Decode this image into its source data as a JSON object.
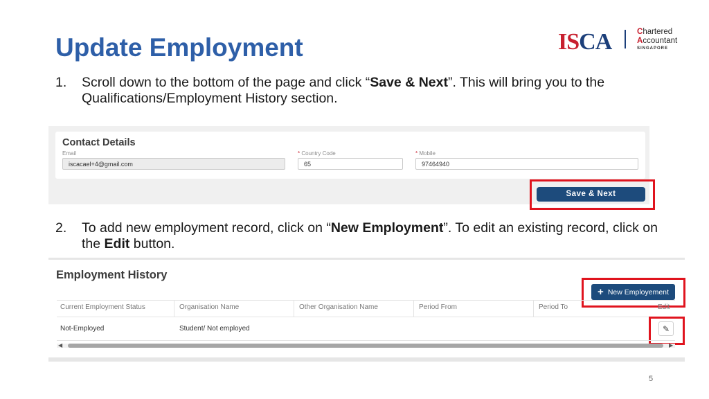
{
  "slide": {
    "title": "Update Employment",
    "page_number": "5"
  },
  "logo": {
    "isca_letters": [
      "I",
      "S",
      "C",
      "A"
    ],
    "line1_cap": "C",
    "line1_rest": "hartered",
    "line2_cap": "A",
    "line2_rest": "ccountant",
    "line3": "SINGAPORE",
    "colors": {
      "red": "#c8202f",
      "navy": "#1c3f7a"
    }
  },
  "step1": {
    "number": "1.",
    "text_before": "Scroll down to the bottom of the page and click “",
    "bold": "Save & Next",
    "text_after": "”. This will bring you to the Qualifications/Employment History section."
  },
  "step2": {
    "number": "2.",
    "text_before": "To add new employment record, click on “",
    "bold1": "New Employment",
    "text_middle": "”. To edit an existing record, click on the ",
    "bold2": "Edit",
    "text_after": " button."
  },
  "contact": {
    "title": "Contact Details",
    "email_label": "Email",
    "email_value": "iscacael+4@gmail.com",
    "country_code_label": "Country Code",
    "country_code_value": "65",
    "mobile_label": "Mobile",
    "mobile_value": "97464940",
    "required_mark": "*",
    "save_button": "Save & Next"
  },
  "employment": {
    "title": "Employment History",
    "new_button": "New Employement",
    "new_button_icon": "plus-icon",
    "columns": [
      "Current Employment Status",
      "Organisation Name",
      "Other Organisation Name",
      "Period From",
      "Period To",
      "Edit"
    ],
    "rows": [
      {
        "status": "Not-Employed",
        "organisation": "Student/ Not employed",
        "other": "",
        "from": "",
        "to": ""
      }
    ],
    "edit_icon": "pencil-icon"
  },
  "colors": {
    "title": "#2e5fa8",
    "button": "#1d4b7c",
    "highlight": "#e0141e"
  }
}
